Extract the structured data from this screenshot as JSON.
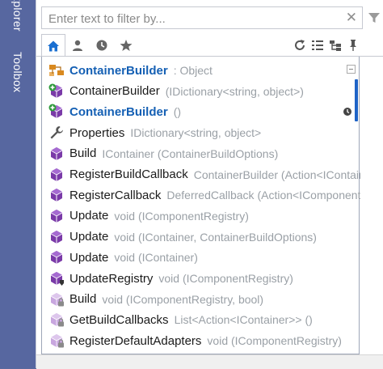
{
  "side_tabs": {
    "explorer": "xplorer",
    "toolbox": "Toolbox"
  },
  "filter": {
    "placeholder": "Enter text to filter by..."
  },
  "toolbar": {
    "tabs": [
      "home-icon",
      "person-icon",
      "clock-icon",
      "star-icon"
    ],
    "actions": [
      "refresh-icon",
      "list-icon",
      "hierarchy-icon",
      "pin-icon"
    ]
  },
  "colors": {
    "accent": "#1560b4",
    "sidebar": "#5767a0",
    "purple": "#7a3aa8",
    "orange": "#d9891f"
  },
  "items": [
    {
      "name": "ContainerBuilder",
      "sig": ": Object",
      "icon": "class-icon",
      "bold": true
    },
    {
      "name": "ContainerBuilder",
      "sig": "(IDictionary<string, object>)",
      "icon": "constructor-icon",
      "bold": false
    },
    {
      "name": "ContainerBuilder",
      "sig": "()",
      "icon": "constructor-icon",
      "bold": true
    },
    {
      "name": "Properties",
      "sig": "IDictionary<string, object>",
      "icon": "wrench-icon",
      "bold": false
    },
    {
      "name": "Build",
      "sig": "IContainer (ContainerBuildOptions)",
      "icon": "method-icon",
      "bold": false
    },
    {
      "name": "RegisterBuildCallback",
      "sig": "ContainerBuilder (Action<IContainer",
      "icon": "method-icon",
      "bold": false
    },
    {
      "name": "RegisterCallback",
      "sig": "DeferredCallback (Action<IComponentReg",
      "icon": "method-icon",
      "bold": false
    },
    {
      "name": "Update",
      "sig": "void (IComponentRegistry)",
      "icon": "method-icon",
      "bold": false
    },
    {
      "name": "Update",
      "sig": "void (IContainer, ContainerBuildOptions)",
      "icon": "method-icon",
      "bold": false
    },
    {
      "name": "Update",
      "sig": "void (IContainer)",
      "icon": "method-icon",
      "bold": false
    },
    {
      "name": "UpdateRegistry",
      "sig": "void (IComponentRegistry)",
      "icon": "method-shield-icon",
      "bold": false
    },
    {
      "name": "Build",
      "sig": "void (IComponentRegistry, bool)",
      "icon": "private-method-icon",
      "bold": false
    },
    {
      "name": "GetBuildCallbacks",
      "sig": "List<Action<IContainer>> ()",
      "icon": "private-method-icon",
      "bold": false
    },
    {
      "name": "RegisterDefaultAdapters",
      "sig": "void (IComponentRegistry)",
      "icon": "private-method-icon",
      "bold": false
    }
  ]
}
